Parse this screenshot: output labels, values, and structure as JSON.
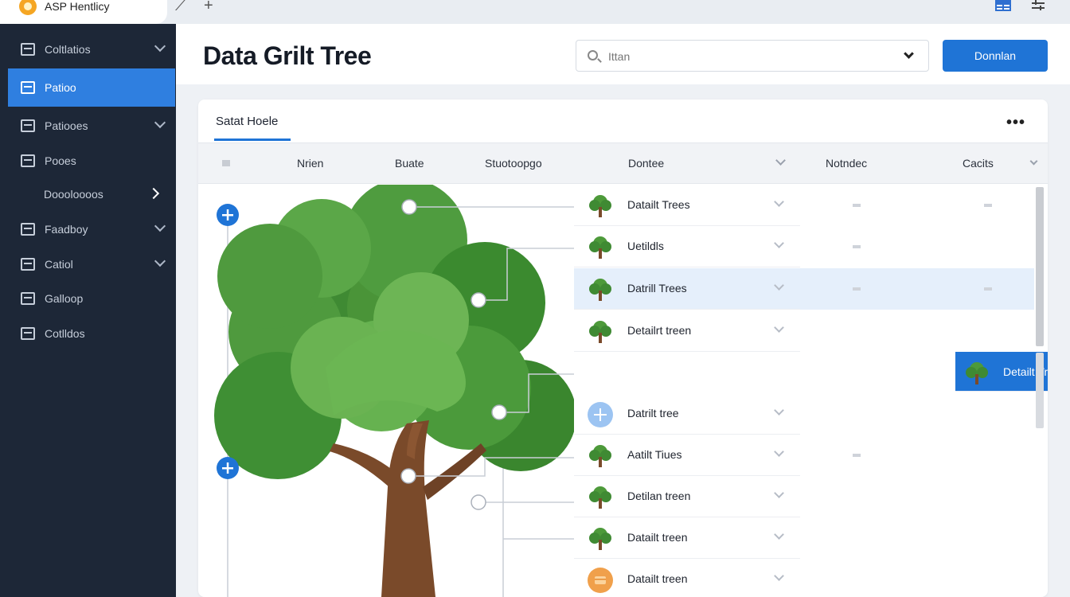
{
  "browser": {
    "tab_title": "ASP Hentlicy",
    "edit_glyph": "⟋",
    "new_tab_glyph": "+"
  },
  "sidebar": {
    "items": [
      {
        "label": "Coltlatios",
        "icon": "grid-icon",
        "has_chevron": true
      },
      {
        "label": "Patioo",
        "icon": "table-icon",
        "active": true
      },
      {
        "label": "Patiooes",
        "icon": "lock-icon",
        "has_chevron": true
      },
      {
        "label": "Pooes",
        "icon": "image-icon"
      },
      {
        "label": "Doooloooos",
        "icon": "",
        "has_chevron_right": true
      },
      {
        "label": "Faadboy",
        "icon": "chart-icon",
        "has_chevron": true
      },
      {
        "label": "Catiol",
        "icon": "panel-icon",
        "has_chevron": true
      },
      {
        "label": "Galloop",
        "icon": "gift-icon"
      },
      {
        "label": "Cotlldos",
        "icon": "list-icon"
      }
    ]
  },
  "header": {
    "title": "Data Grilt Tree",
    "search_placeholder": "Ittan",
    "primary_button": "Donnlan"
  },
  "panel": {
    "tab_label": "Satat Hoele",
    "more_glyph": "•••",
    "columns": [
      "Nrien",
      "Buate",
      "Stuotoopgo",
      "Dontee",
      "Notndec",
      "Cacits"
    ]
  },
  "rows": [
    {
      "label": "Datailt Trees",
      "icon": "tree-icon"
    },
    {
      "label": "Uetildls",
      "icon": "tree-icon"
    },
    {
      "label": "Datrill Trees",
      "icon": "tree-icon"
    },
    {
      "label": "Detailrt treen",
      "icon": "tree-icon"
    },
    {
      "label": "Detailt Tree",
      "icon": "tree-icon"
    },
    {
      "label": "Datrilt tree",
      "icon": "add-circle-icon"
    },
    {
      "label": "Aatilt Tiues",
      "icon": "tree-icon"
    },
    {
      "label": "Detilan treen",
      "icon": "tree-icon"
    },
    {
      "label": "Datailt treen",
      "icon": "tree-icon"
    },
    {
      "label": "Datailt treen",
      "icon": "orange-folder-icon"
    }
  ],
  "colors": {
    "sidebar_bg": "#1d2737",
    "active_blue": "#2f7fe0",
    "primary_blue": "#1f74d6",
    "tree_green": "#4d9a3a",
    "trunk_brown": "#7a4a2a"
  }
}
